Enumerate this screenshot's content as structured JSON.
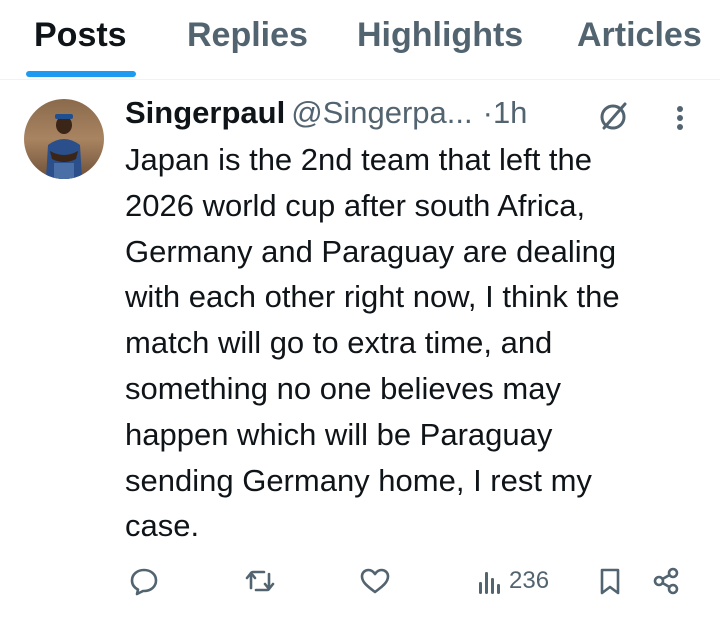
{
  "tabs": [
    {
      "label": "Posts",
      "active": true
    },
    {
      "label": "Replies",
      "active": false
    },
    {
      "label": "Highlights",
      "active": false
    },
    {
      "label": "Articles",
      "active": false
    }
  ],
  "colors": {
    "accent": "#1d9bf0",
    "text_primary": "#0f1419",
    "text_secondary": "#536471",
    "divider": "#eff3f4"
  },
  "post": {
    "display_name": "Singerpaul",
    "handle": "@Singerpa...",
    "separator": "·",
    "time": "1h",
    "text": "Japan is the 2nd team that left the\n2026 world cup after south Africa,\nGermany and Paraguay are dealing\nwith each other right now, I think the\nmatch will go to extra time, and\nsomething no one believes may\nhappen which will be Paraguay\nsending Germany home, I rest my\ncase.",
    "views": "236"
  },
  "icons": {
    "grok": "grok-icon",
    "more": "more-dots-icon",
    "reply": "reply-icon",
    "repost": "repost-icon",
    "like": "heart-icon",
    "views": "views-icon",
    "bookmark": "bookmark-icon",
    "share": "share-icon"
  }
}
